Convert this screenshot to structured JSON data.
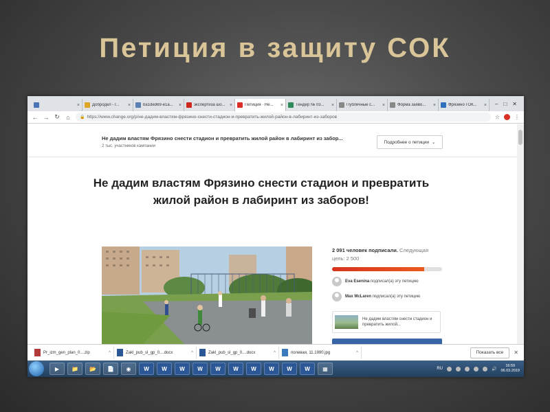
{
  "slide": {
    "title": "Петиция в защиту СОК"
  },
  "browser": {
    "tabs": [
      {
        "label": "",
        "color": "#4a74b5"
      },
      {
        "label": "Добродел - г...",
        "color": "#e0a526"
      },
      {
        "label": "ba1ded69-e1a...",
        "color": "#5a7fb0"
      },
      {
        "label": "экспертиза шо...",
        "color": "#cc2a1e"
      },
      {
        "label": "Петиция · Не...",
        "color": "#d93025",
        "active": true
      },
      {
        "label": "Тендер № 03...",
        "color": "#2e8b57"
      },
      {
        "label": "Публичные с...",
        "color": "#888888"
      },
      {
        "label": "Форма заяво...",
        "color": "#888888"
      },
      {
        "label": "Фрязино ГОК...",
        "color": "#2f6fbd"
      }
    ],
    "url": "https://www.change.org/p/не-дадим-властям-фрязино-снести-стадион-и-превратить-жилой-район-в-лабиринт-из-заборов"
  },
  "page": {
    "sticky_title": "Не дадим властям Фрязино снести стадион и превратить жилой район в лабиринт из забор...",
    "sticky_sub": "2 тыс. участников кампании",
    "more_button": "Подробнее о петиции",
    "petition_title": "Не дадим властям Фрязино снести стадион и превратить жилой район в лабиринт из заборов!",
    "signed_count": "2 091 человек подписали.",
    "signed_next": "Следующая цель: 2 500",
    "progress_fraction": 0.84,
    "signers": [
      {
        "name": "Eva Esenina",
        "action": "подписал(а) эту петицию"
      },
      {
        "name": "Max McLaren",
        "action": "подписал(а) эту петицию"
      }
    ],
    "share_text": "Не дадим властям снести стадион и превратить жилой...",
    "colors": {
      "progress": "#e2401f",
      "button": "#3a64a8"
    }
  },
  "downloads": {
    "items": [
      {
        "name": "Pr_izm_gen_plan_0....zip",
        "icon": "zip-file-icon"
      },
      {
        "name": "Zakl_pub_sl_gp_0....docx",
        "icon": "word-file-icon"
      },
      {
        "name": "Zakl_pub_sl_gp_0....docx",
        "icon": "word-file-icon"
      },
      {
        "name": "полевая, 11.1990.jpg",
        "icon": "image-file-icon"
      }
    ],
    "show_all": "Показать все"
  },
  "taskbar": {
    "lang": "RU",
    "time": "16:59",
    "date": "06.03.2019"
  }
}
